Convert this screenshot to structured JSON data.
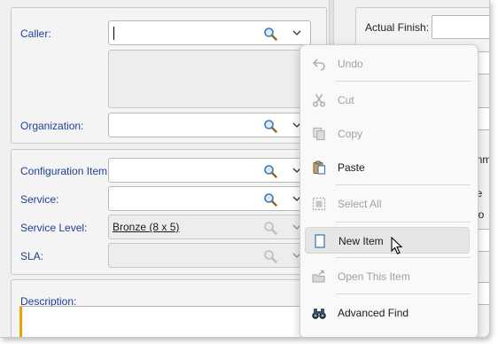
{
  "form": {
    "caller": {
      "label": "Caller:",
      "value": ""
    },
    "organization": {
      "label": "Organization:",
      "value": ""
    },
    "configuration_item": {
      "label": "Configuration Item:",
      "value": ""
    },
    "service": {
      "label": "Service:",
      "value": ""
    },
    "service_level": {
      "label": "Service Level:",
      "value": "Bronze (8 x 5)"
    },
    "sla": {
      "label": "SLA:",
      "value": ""
    },
    "description": {
      "label": "Description:"
    }
  },
  "right_panel": {
    "actual_finish_label": "Actual Finish:",
    "clipped_text_1": "gnm",
    "clipped_text_2": "n pe",
    "clipped_text_3": "n wo"
  },
  "context_menu": {
    "items": [
      {
        "label": "Undo",
        "icon": "undo-icon",
        "enabled": false
      },
      {
        "label": "Cut",
        "icon": "scissors-icon",
        "enabled": false
      },
      {
        "label": "Copy",
        "icon": "copy-icon",
        "enabled": false
      },
      {
        "label": "Paste",
        "icon": "paste-icon",
        "enabled": true
      },
      {
        "label": "Select All",
        "icon": "select-all-icon",
        "enabled": false
      },
      {
        "label": "New Item",
        "icon": "new-item-icon",
        "enabled": true,
        "hovered": true
      },
      {
        "label": "Open This Item",
        "icon": "open-item-icon",
        "enabled": false
      },
      {
        "label": "Advanced Find",
        "icon": "binoculars-icon",
        "enabled": true
      }
    ]
  },
  "colors": {
    "label_blue": "#1f3f99",
    "accent_orange": "#f0a000"
  }
}
